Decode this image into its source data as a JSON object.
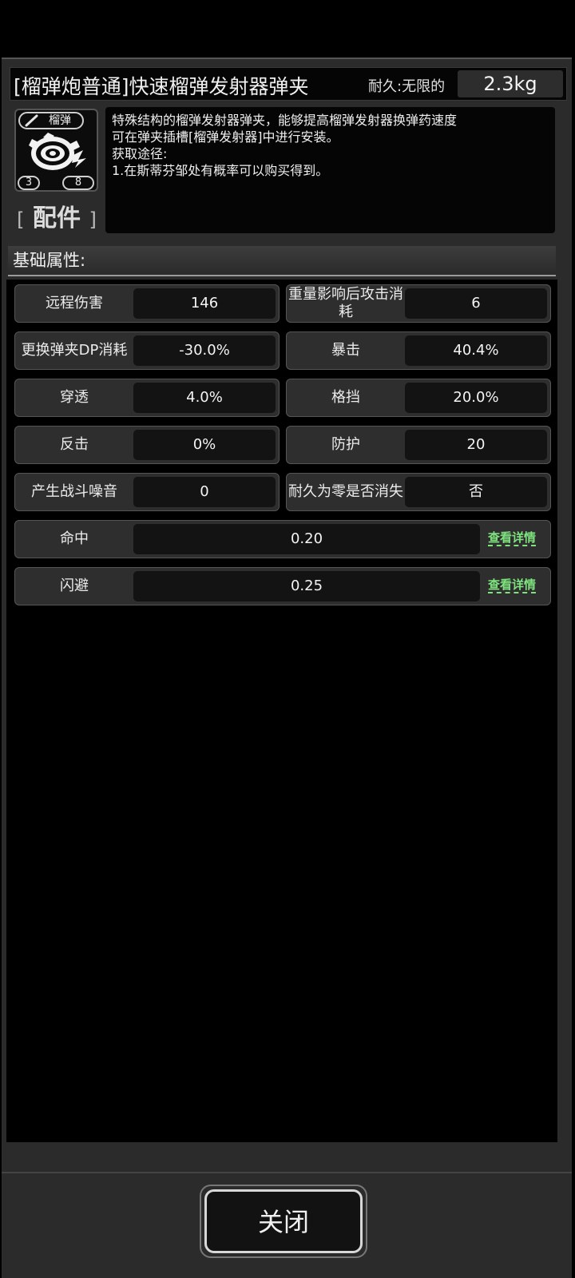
{
  "item": {
    "title": "[榴弹炮普通]快速榴弹发射器弹夹",
    "durability": "耐久:无限的",
    "weight": "2.3kg",
    "tag": "榴弹",
    "badge_left": "3",
    "badge_right": "8",
    "category": "配件",
    "description": [
      "特殊结构的榴弹发射器弹夹，能够提高榴弹发射器换弹药速度",
      "可在弹夹插槽[榴弹发射器]中进行安装。",
      "获取途径:",
      "1.在斯蒂芬邹处有概率可以购买得到。"
    ]
  },
  "section": {
    "title": "基础属性:"
  },
  "stats": [
    {
      "label": "远程伤害",
      "value": "146"
    },
    {
      "label": "重量影响后攻击消耗",
      "value": "6"
    },
    {
      "label": "更换弹夹DP消耗",
      "value": "-30.0%"
    },
    {
      "label": "暴击",
      "value": "40.4%"
    },
    {
      "label": "穿透",
      "value": "4.0%"
    },
    {
      "label": "格挡",
      "value": "20.0%"
    },
    {
      "label": "反击",
      "value": "0%"
    },
    {
      "label": "防护",
      "value": "20"
    },
    {
      "label": "产生战斗噪音",
      "value": "0"
    },
    {
      "label": "耐久为零是否消失",
      "value": "否"
    }
  ],
  "full_stats": [
    {
      "label": "命中",
      "value": "0.20",
      "link": "查看详情"
    },
    {
      "label": "闪避",
      "value": "0.25",
      "link": "查看详情"
    }
  ],
  "footer": {
    "close_label": "关闭"
  },
  "icons": {
    "tag_icon": "pencil-icon",
    "item_icon": "grenade-magazine-icon"
  }
}
